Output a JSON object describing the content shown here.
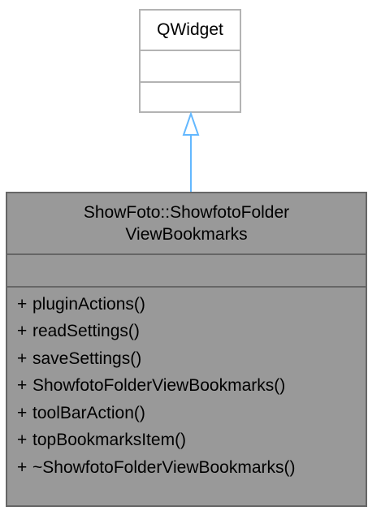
{
  "parent_class": {
    "name": "QWidget"
  },
  "derived_class": {
    "name_line1": "ShowFoto::ShowfotoFolder",
    "name_line2": "ViewBookmarks",
    "operations": [
      {
        "visibility": "+",
        "name": "pluginActions()"
      },
      {
        "visibility": "+",
        "name": "readSettings()"
      },
      {
        "visibility": "+",
        "name": "saveSettings()"
      },
      {
        "visibility": "+",
        "name": "ShowfotoFolderViewBookmarks()"
      },
      {
        "visibility": "+",
        "name": "toolBarAction()"
      },
      {
        "visibility": "+",
        "name": "topBookmarksItem()"
      },
      {
        "visibility": "+",
        "name": "~ShowfotoFolderViewBookmarks()"
      }
    ]
  },
  "colors": {
    "arrow": "#63b8ff",
    "parent_border": "#b3b3b3",
    "derived_fill": "#999999",
    "derived_border": "#666666"
  }
}
